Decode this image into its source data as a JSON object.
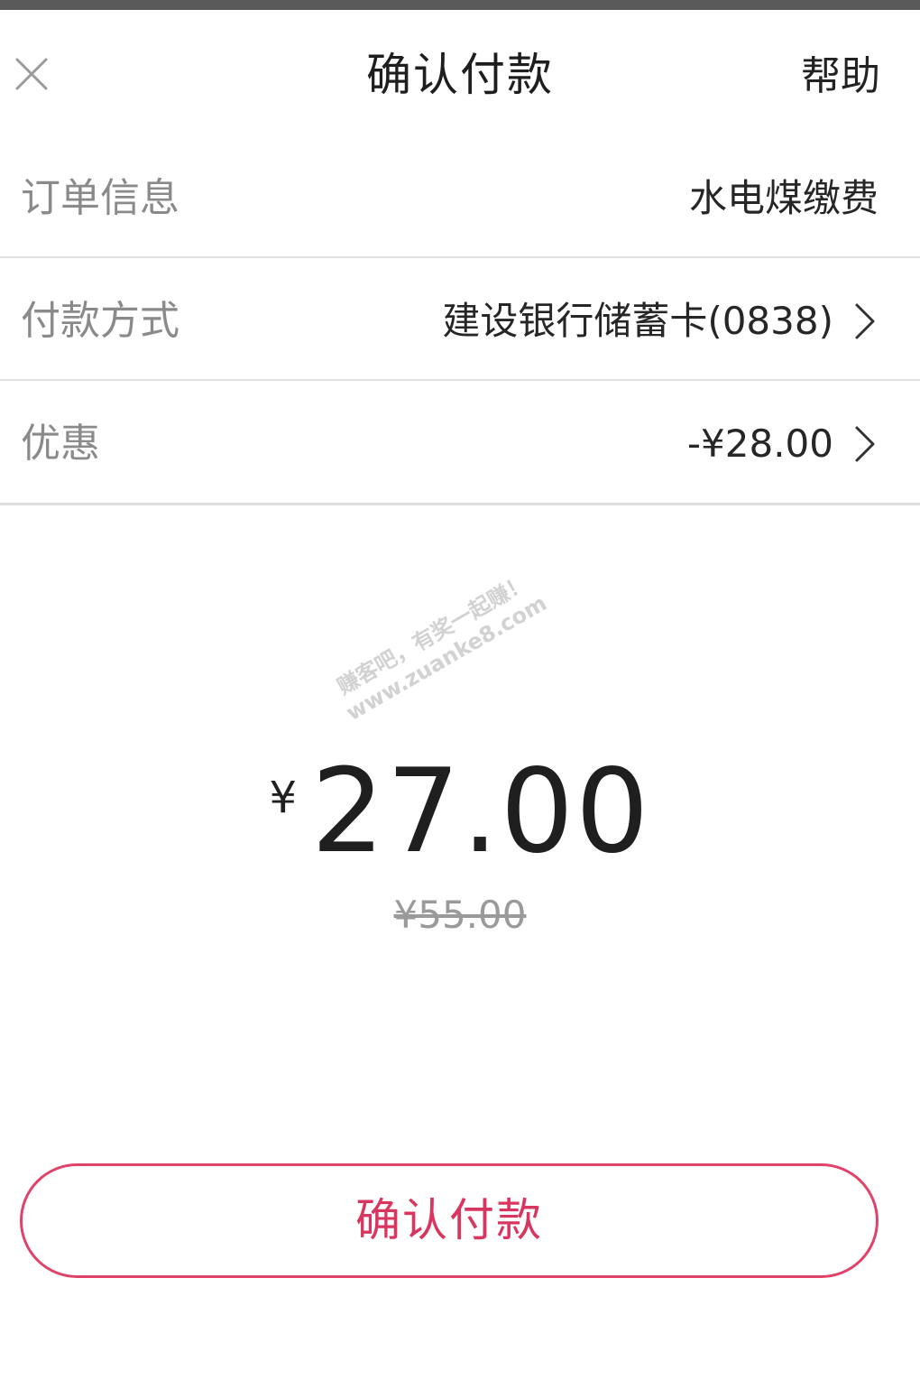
{
  "nav": {
    "title": "确认付款",
    "help_label": "帮助",
    "close_icon": "close-icon"
  },
  "rows": {
    "order": {
      "label": "订单信息",
      "value": "水电煤缴费"
    },
    "payment": {
      "label": "付款方式",
      "value": "建设银行储蓄卡(0838)",
      "icon": "chevron-right-icon"
    },
    "discount": {
      "label": "优惠",
      "value": "-¥28.00",
      "icon": "chevron-right-icon"
    }
  },
  "watermark": {
    "line1": "赚客吧，有奖一起赚！",
    "line2": "www.zuanke8.com"
  },
  "amount": {
    "currency_symbol": "¥",
    "value": "27.00",
    "original_price": "¥55.00"
  },
  "confirm_button": {
    "label": "确认付款"
  },
  "colors": {
    "accent": "#e0436a",
    "label_gray": "#8a8a8a",
    "divider": "#e2e2e2"
  }
}
